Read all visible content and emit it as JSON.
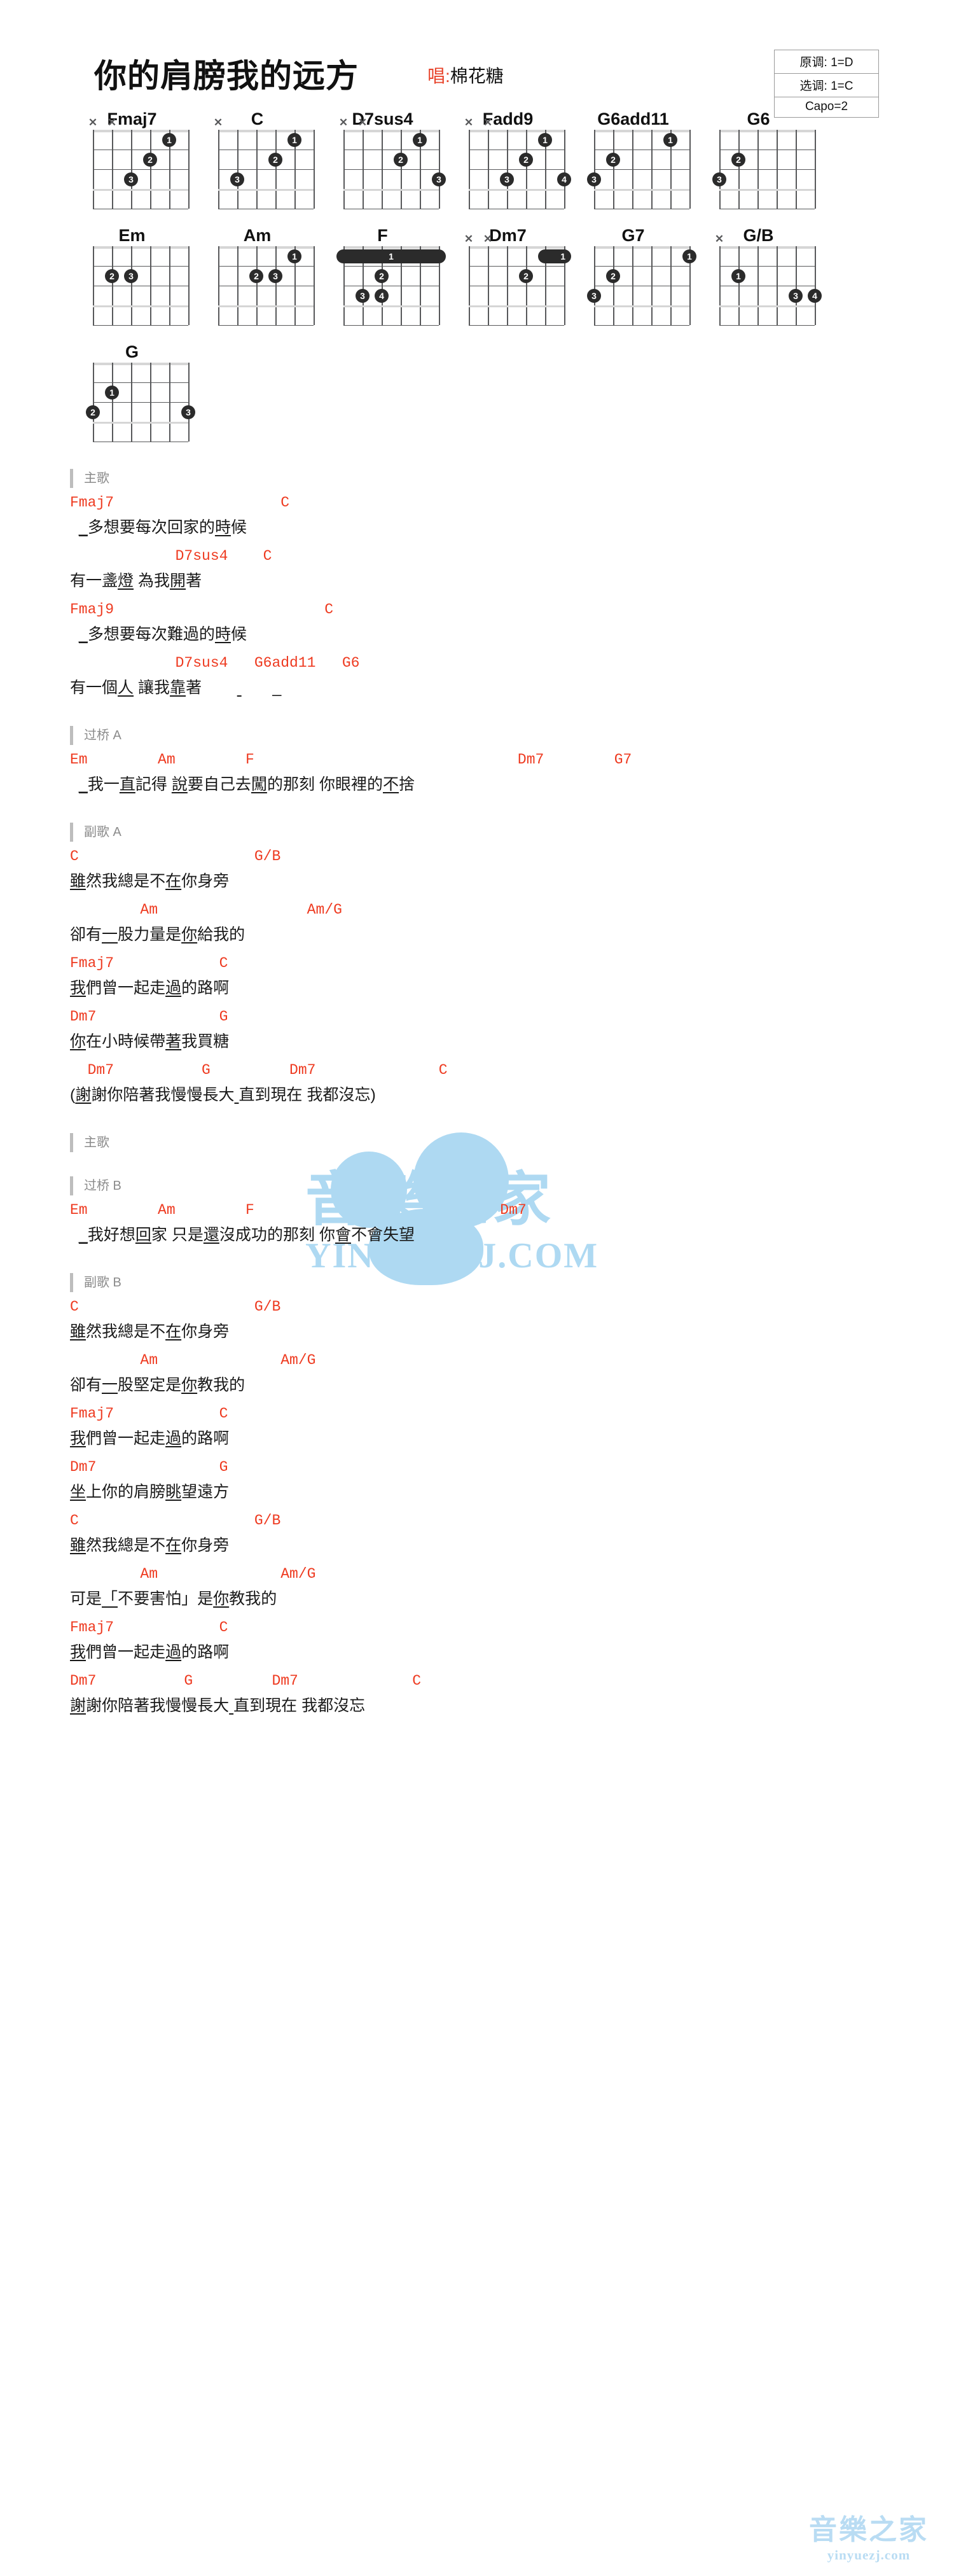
{
  "header": {
    "title": "你的肩膀我的远方",
    "singer_label": "唱:",
    "singer_name": "棉花糖",
    "key_original": "原调: 1=D",
    "key_selected": "选调: 1=C",
    "capo": "Capo=2"
  },
  "watermark": {
    "main_text": "音樂之家",
    "main_sub": "YINYUEZJ.COM",
    "bottom_text": "音樂之家",
    "bottom_sub": "yinyuezj.com"
  },
  "chords": [
    [
      {
        "name": "Fmaj7",
        "mutes": [
          0,
          1
        ],
        "dots": [
          {
            "string": 4,
            "fret": 1,
            "finger": "1"
          },
          {
            "string": 3,
            "fret": 2,
            "finger": "2"
          },
          {
            "string": 2,
            "fret": 3,
            "finger": "3"
          }
        ]
      },
      {
        "name": "C",
        "mutes": [
          0
        ],
        "dots": [
          {
            "string": 4,
            "fret": 1,
            "finger": "1"
          },
          {
            "string": 3,
            "fret": 2,
            "finger": "2"
          },
          {
            "string": 1,
            "fret": 3,
            "finger": "3"
          }
        ]
      },
      {
        "name": "D7sus4",
        "mutes": [
          0,
          1
        ],
        "dots": [
          {
            "string": 4,
            "fret": 1,
            "finger": "1"
          },
          {
            "string": 3,
            "fret": 2,
            "finger": "2"
          },
          {
            "string": 5,
            "fret": 3,
            "finger": "3"
          }
        ]
      },
      {
        "name": "Fadd9",
        "mutes": [
          0,
          1
        ],
        "dots": [
          {
            "string": 4,
            "fret": 1,
            "finger": "1"
          },
          {
            "string": 3,
            "fret": 2,
            "finger": "2"
          },
          {
            "string": 2,
            "fret": 3,
            "finger": "3"
          },
          {
            "string": 5,
            "fret": 3,
            "finger": "4"
          }
        ]
      },
      {
        "name": "G6add11",
        "mutes": [],
        "dots": [
          {
            "string": 4,
            "fret": 1,
            "finger": "1"
          },
          {
            "string": 1,
            "fret": 2,
            "finger": "2"
          },
          {
            "string": 0,
            "fret": 3,
            "finger": "3"
          }
        ]
      },
      {
        "name": "G6",
        "mutes": [],
        "dots": [
          {
            "string": 1,
            "fret": 2,
            "finger": "2"
          },
          {
            "string": 0,
            "fret": 3,
            "finger": "3"
          }
        ]
      }
    ],
    [
      {
        "name": "Em",
        "mutes": [],
        "dots": [
          {
            "string": 1,
            "fret": 2,
            "finger": "2"
          },
          {
            "string": 2,
            "fret": 2,
            "finger": "3"
          }
        ]
      },
      {
        "name": "Am",
        "mutes": [],
        "dots": [
          {
            "string": 4,
            "fret": 1,
            "finger": "1"
          },
          {
            "string": 2,
            "fret": 2,
            "finger": "2"
          },
          {
            "string": 3,
            "fret": 2,
            "finger": "3"
          }
        ]
      },
      {
        "name": "F",
        "mutes": [],
        "barre": {
          "fret": 1,
          "from": 0,
          "to": 5,
          "finger": "1"
        },
        "dots": [
          {
            "string": 2,
            "fret": 2,
            "finger": "2"
          },
          {
            "string": 1,
            "fret": 3,
            "finger": "3"
          },
          {
            "string": 2,
            "fret": 3,
            "finger": "4"
          }
        ]
      },
      {
        "name": "Dm7",
        "mutes": [
          0,
          1
        ],
        "barre": {
          "fret": 1,
          "from": 4,
          "to": 5,
          "finger": "1",
          "right": true
        },
        "dots": [
          {
            "string": 3,
            "fret": 2,
            "finger": "2"
          }
        ]
      },
      {
        "name": "G7",
        "mutes": [],
        "dots": [
          {
            "string": 5,
            "fret": 1,
            "finger": "1"
          },
          {
            "string": 1,
            "fret": 2,
            "finger": "2"
          },
          {
            "string": 0,
            "fret": 3,
            "finger": "3"
          }
        ]
      },
      {
        "name": "G/B",
        "mutes": [
          0
        ],
        "dots": [
          {
            "string": 1,
            "fret": 2,
            "finger": "1"
          },
          {
            "string": 4,
            "fret": 3,
            "finger": "3"
          },
          {
            "string": 5,
            "fret": 3,
            "finger": "4"
          }
        ]
      }
    ],
    [
      {
        "name": "G",
        "mutes": [],
        "dots": [
          {
            "string": 1,
            "fret": 2,
            "finger": "1"
          },
          {
            "string": 0,
            "fret": 3,
            "finger": "2"
          },
          {
            "string": 5,
            "fret": 3,
            "finger": "3"
          }
        ]
      }
    ]
  ],
  "sections": [
    {
      "label": "主歌",
      "lines": [
        {
          "chords": "Fmaj7                   C",
          "lyrics": "  _多想要每次回家的時候"
        },
        {
          "chords": "            D7sus4    C",
          "lyrics": "有一盞燈 為我開著"
        },
        {
          "chords": "Fmaj9                        C",
          "lyrics": "  _多想要每次難過的時候"
        },
        {
          "chords": "            D7sus4   G6add11   G6",
          "lyrics": "有一個人 讓我靠著                _"
        }
      ]
    },
    {
      "label": "过桥 A",
      "lines": [
        {
          "chords": "Em        Am        F                              Dm7        G7",
          "lyrics": "  _我一直記得 說要自己去闖的那刻 你眼裡的不捨"
        }
      ]
    },
    {
      "label": "副歌 A",
      "lines": [
        {
          "chords": "C                    G/B",
          "lyrics": "雖然我總是不在你身旁"
        },
        {
          "chords": "        Am                 Am/G",
          "lyrics": "卻有一股力量是你給我的"
        },
        {
          "chords": "Fmaj7            C",
          "lyrics": "我們曾一起走過的路啊"
        },
        {
          "chords": "Dm7              G",
          "lyrics": "你在小時候帶著我買糖"
        },
        {
          "chords": "  Dm7          G         Dm7              C",
          "lyrics": "(謝謝你陪著我慢慢長大 直到現在 我都沒忘)"
        }
      ]
    },
    {
      "label": "主歌",
      "lines": []
    },
    {
      "label": "过桥 B",
      "lines": [
        {
          "chords": "Em        Am        F                            Dm7",
          "lyrics": "  _我好想回家 只是還沒成功的那刻 你會不會失望"
        }
      ]
    },
    {
      "label": "副歌 B",
      "lines": [
        {
          "chords": "C                    G/B",
          "lyrics": "雖然我總是不在你身旁"
        },
        {
          "chords": "        Am              Am/G",
          "lyrics": "卻有一股堅定是你教我的"
        },
        {
          "chords": "Fmaj7            C",
          "lyrics": "我們曾一起走過的路啊"
        },
        {
          "chords": "Dm7              G",
          "lyrics": "坐上你的肩膀眺望遠方"
        },
        {
          "chords": "C                    G/B",
          "lyrics": "雖然我總是不在你身旁"
        },
        {
          "chords": "        Am              Am/G",
          "lyrics": "可是「不要害怕」是你教我的"
        },
        {
          "chords": "Fmaj7            C",
          "lyrics": "我們曾一起走過的路啊"
        },
        {
          "chords": "Dm7          G         Dm7             C",
          "lyrics": "謝謝你陪著我慢慢長大 直到現在 我都沒忘"
        }
      ]
    }
  ]
}
